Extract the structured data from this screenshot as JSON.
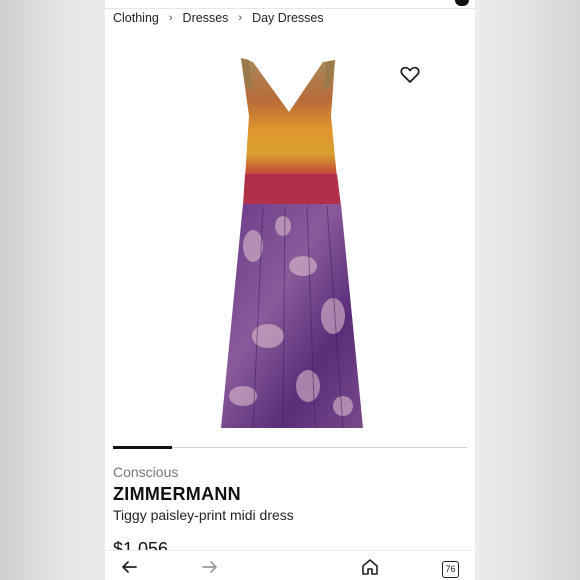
{
  "breadcrumb": {
    "items": [
      "Clothing",
      "Dresses",
      "Day Dresses"
    ],
    "separator": "›"
  },
  "product": {
    "tag": "Conscious",
    "brand": "ZIMMERMANN",
    "name": "Tiggy paisley-print midi dress",
    "price": "$1,056",
    "image_description": "sleeveless paisley-print midi dress with ruched bodice",
    "colors": [
      "#8a5a3a",
      "#d88a2e",
      "#c23a3a",
      "#5a2d7a",
      "#e8c7d3"
    ]
  },
  "gallery": {
    "active_index": 0
  },
  "navbar": {
    "back_icon": "back-arrow-icon",
    "forward_icon": "forward-arrow-icon",
    "home_icon": "home-icon",
    "tab_count": "76"
  },
  "icons": {
    "wishlist": "heart-icon"
  }
}
